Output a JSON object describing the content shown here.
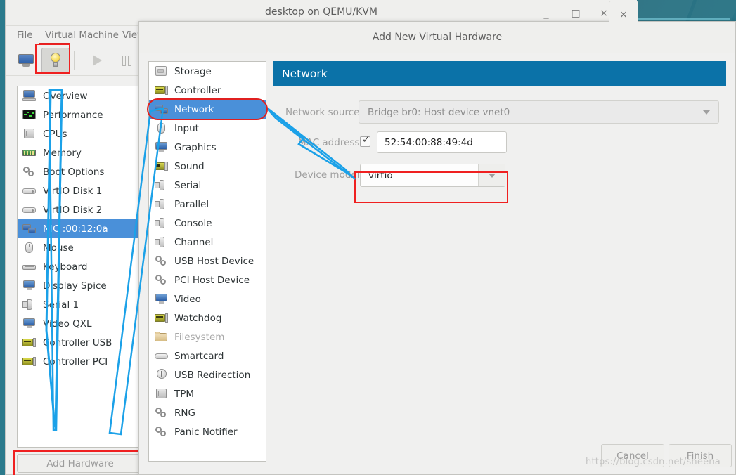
{
  "main_window": {
    "title": "desktop on QEMU/KVM",
    "window_buttons": {
      "minimize": "_",
      "maximize": "□",
      "close": "×"
    },
    "menus": [
      "File",
      "Virtual Machine",
      "View"
    ],
    "toolbar": [
      {
        "name": "console-view",
        "icon": "monitor-icon"
      },
      {
        "name": "show-details",
        "icon": "lightbulb-icon",
        "pressed": true
      },
      {
        "name": "run",
        "icon": "play-icon",
        "disabled": true
      },
      {
        "name": "pause",
        "icon": "pause-icon",
        "disabled": true
      }
    ],
    "hardware_list": [
      {
        "label": "Overview",
        "icon": "computer-icon",
        "selected": false
      },
      {
        "label": "Performance",
        "icon": "performance-graph-icon",
        "selected": false
      },
      {
        "label": "CPUs",
        "icon": "cpu-chip-icon",
        "selected": false
      },
      {
        "label": "Memory",
        "icon": "memory-stick-icon",
        "selected": false
      },
      {
        "label": "Boot Options",
        "icon": "gears-icon",
        "selected": false
      },
      {
        "label": "VirtIO Disk 1",
        "icon": "disk-icon",
        "selected": false
      },
      {
        "label": "VirtIO Disk 2",
        "icon": "disk-icon",
        "selected": false
      },
      {
        "label": "NIC :00:12:0a",
        "icon": "network-card-icon",
        "selected": true
      },
      {
        "label": "Mouse",
        "icon": "mouse-icon",
        "selected": false
      },
      {
        "label": "Keyboard",
        "icon": "keyboard-icon",
        "selected": false
      },
      {
        "label": "Display Spice",
        "icon": "display-icon",
        "selected": false
      },
      {
        "label": "Serial 1",
        "icon": "serial-port-icon",
        "selected": false
      },
      {
        "label": "Video QXL",
        "icon": "display-icon",
        "selected": false
      },
      {
        "label": "Controller USB",
        "icon": "controller-card-icon",
        "selected": false
      },
      {
        "label": "Controller PCI",
        "icon": "controller-card-icon",
        "selected": false
      }
    ],
    "add_hardware_label": "Add Hardware"
  },
  "dialog": {
    "title": "Add New Virtual Hardware",
    "close_label": "×",
    "device_list": [
      {
        "label": "Storage",
        "icon": "storage-icon",
        "selected": false,
        "disabled": false
      },
      {
        "label": "Controller",
        "icon": "controller-card-icon",
        "selected": false,
        "disabled": false
      },
      {
        "label": "Network",
        "icon": "network-card-icon",
        "selected": true,
        "disabled": false
      },
      {
        "label": "Input",
        "icon": "mouse-icon",
        "selected": false,
        "disabled": false
      },
      {
        "label": "Graphics",
        "icon": "display-icon",
        "selected": false,
        "disabled": false
      },
      {
        "label": "Sound",
        "icon": "sound-card-icon",
        "selected": false,
        "disabled": false
      },
      {
        "label": "Serial",
        "icon": "serial-port-icon",
        "selected": false,
        "disabled": false
      },
      {
        "label": "Parallel",
        "icon": "serial-port-icon",
        "selected": false,
        "disabled": false
      },
      {
        "label": "Console",
        "icon": "serial-port-icon",
        "selected": false,
        "disabled": false
      },
      {
        "label": "Channel",
        "icon": "serial-port-icon",
        "selected": false,
        "disabled": false
      },
      {
        "label": "USB Host Device",
        "icon": "gears-icon",
        "selected": false,
        "disabled": false
      },
      {
        "label": "PCI Host Device",
        "icon": "gears-icon",
        "selected": false,
        "disabled": false
      },
      {
        "label": "Video",
        "icon": "display-icon",
        "selected": false,
        "disabled": false
      },
      {
        "label": "Watchdog",
        "icon": "controller-card-icon",
        "selected": false,
        "disabled": false
      },
      {
        "label": "Filesystem",
        "icon": "folder-icon",
        "selected": false,
        "disabled": true
      },
      {
        "label": "Smartcard",
        "icon": "smartcard-icon",
        "selected": false,
        "disabled": false
      },
      {
        "label": "USB Redirection",
        "icon": "usb-icon",
        "selected": false,
        "disabled": false
      },
      {
        "label": "TPM",
        "icon": "cpu-chip-icon",
        "selected": false,
        "disabled": false
      },
      {
        "label": "RNG",
        "icon": "gears-icon",
        "selected": false,
        "disabled": false
      },
      {
        "label": "Panic Notifier",
        "icon": "gears-icon",
        "selected": false,
        "disabled": false
      }
    ],
    "panel": {
      "header": "Network",
      "header_color": "#0b72a8",
      "fields": {
        "network_source_label": "Network source:",
        "network_source_value": "Bridge br0: Host device vnet0",
        "mac_address_label": "MAC address:",
        "mac_address_checked": true,
        "mac_address_value": "52:54:00:88:49:4d",
        "device_model_label": "Device model:",
        "device_model_value": "virtio"
      }
    },
    "buttons": {
      "cancel": "Cancel",
      "finish": "Finish"
    }
  },
  "annotations": {
    "highlight_color": "#ef2020",
    "arrow_color": "#1ba1e8",
    "watermark": "https://blog.csdn.net/sheena"
  }
}
